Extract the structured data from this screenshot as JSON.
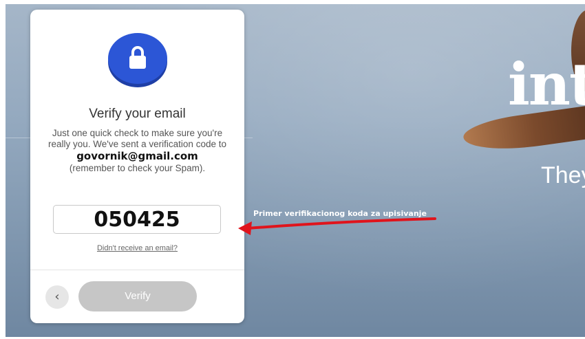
{
  "background": {
    "brand_text": "int",
    "tagline": "They"
  },
  "dialog": {
    "icon": "lock-icon",
    "title": "Verify your email",
    "description": "Just one quick check to make sure you're really you. We've sent a verification code to",
    "email": "govornik@gmail.com",
    "spam_note": "(remember to check your Spam).",
    "code_value": "050425",
    "resend_link": "Didn't receive an email?",
    "back_icon": "chevron-left-icon",
    "back_glyph": "‹",
    "verify_label": "Verify",
    "accent_color": "#2c56d6"
  },
  "annotation": {
    "label": "Primer verifikacionog koda za upisivanje",
    "arrow_color": "#e0141c"
  }
}
